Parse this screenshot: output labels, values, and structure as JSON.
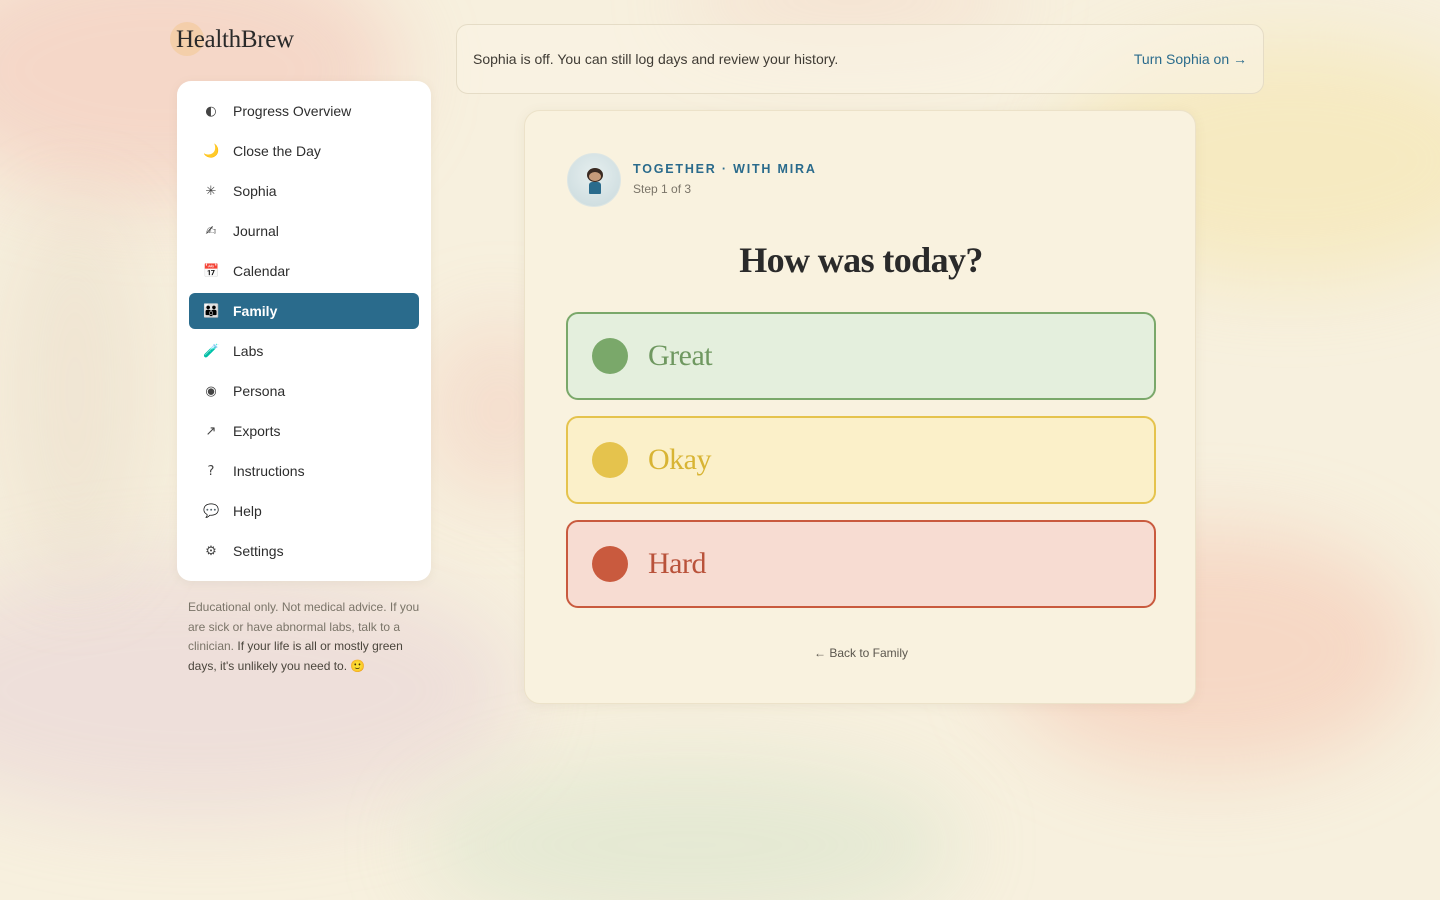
{
  "app": {
    "name": "HealthBrew"
  },
  "banner": {
    "message": "Sophia is off. You can still log days and review your history.",
    "action_label": "Turn Sophia on →"
  },
  "sidebar": {
    "active": "Family",
    "items": [
      {
        "label": "Progress Overview",
        "icon": "half-circle-icon",
        "glyph": "◐"
      },
      {
        "label": "Close the Day",
        "icon": "moon-icon",
        "glyph": "🌙"
      },
      {
        "label": "Sophia",
        "icon": "sparkle-icon",
        "glyph": "✳"
      },
      {
        "label": "Journal",
        "icon": "writing-hand-icon",
        "glyph": "✍"
      },
      {
        "label": "Calendar",
        "icon": "calendar-icon",
        "glyph": "📅"
      },
      {
        "label": "Family",
        "icon": "family-icon",
        "glyph": "👪"
      },
      {
        "label": "Labs",
        "icon": "test-tube-icon",
        "glyph": "🧪"
      },
      {
        "label": "Persona",
        "icon": "radio-dot-icon",
        "glyph": "◉"
      },
      {
        "label": "Exports",
        "icon": "arrow-up-right-icon",
        "glyph": "↗"
      },
      {
        "label": "Instructions",
        "icon": "question-icon",
        "glyph": "?"
      },
      {
        "label": "Help",
        "icon": "speech-bubble-icon",
        "glyph": "💬"
      },
      {
        "label": "Settings",
        "icon": "gear-icon",
        "glyph": "⚙"
      }
    ]
  },
  "disclaimer": {
    "text": "Educational only. Not medical advice. If you are sick or have abnormal labs, talk to a clinician.",
    "emphasis": "If your life is all or mostly green days, it's unlikely you need to.",
    "emoji": "🙂"
  },
  "card": {
    "kicker": "TOGETHER · WITH MIRA",
    "step": "Step 1 of 3",
    "question": "How was today?",
    "options": [
      {
        "label": "Great",
        "color": "#7aa86a"
      },
      {
        "label": "Okay",
        "color": "#e5c34d"
      },
      {
        "label": "Hard",
        "color": "#c95a3e"
      }
    ],
    "back_label": "← Back to Family"
  },
  "colors": {
    "accent": "#2a6b8c",
    "background": "#f7f0de"
  }
}
